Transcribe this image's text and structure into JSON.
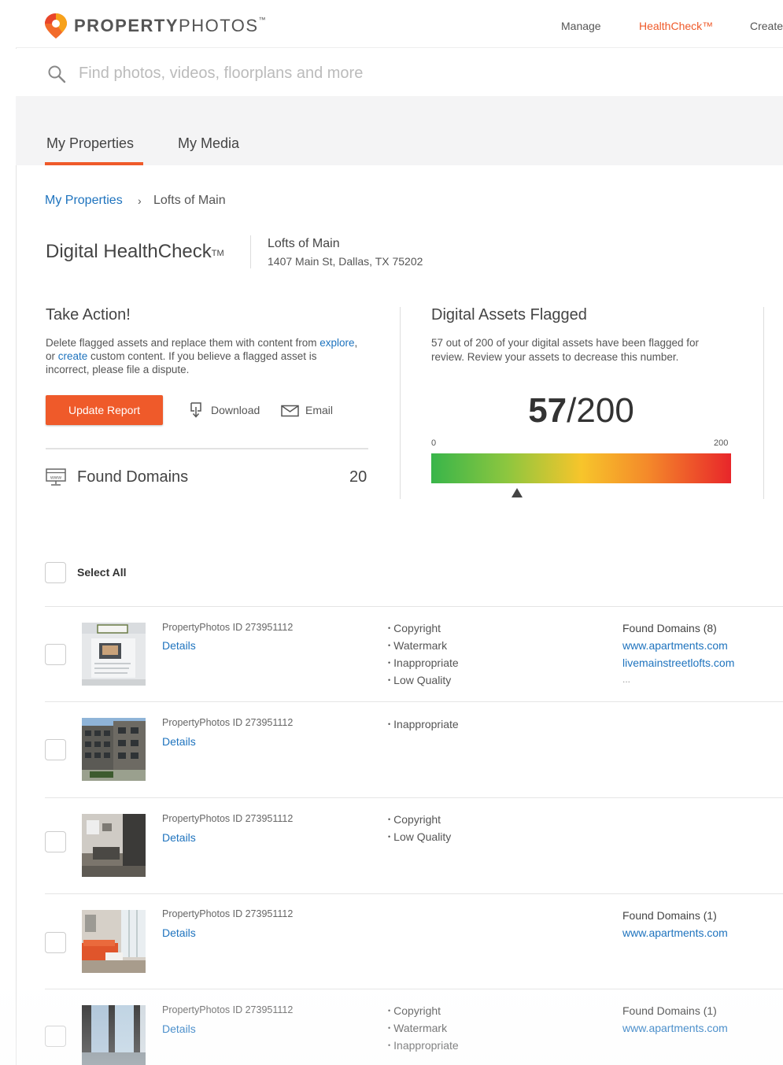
{
  "header": {
    "brand_bold": "PROPERTY",
    "brand_light": "PHOTOS",
    "brand_tm": "™",
    "nav": {
      "manage": "Manage",
      "healthcheck": "HealthCheck™",
      "create": "Create"
    },
    "accent_color": "#ef5a2a"
  },
  "search": {
    "placeholder": "Find photos, videos, floorplans and more"
  },
  "tabs": {
    "my_properties": "My Properties",
    "my_media": "My Media",
    "active": "My Properties"
  },
  "breadcrumb": {
    "link": "My Properties",
    "separator": "›",
    "current": "Lofts of Main"
  },
  "page": {
    "title": "Digital HealthCheck",
    "title_tm": "TM",
    "property_name": "Lofts of Main",
    "property_address": "1407 Main St, Dallas, TX 75202"
  },
  "take_action": {
    "title": "Take Action!",
    "text_1": "Delete flagged assets and replace them with content from ",
    "link_explore": "explore",
    "text_2": ", or ",
    "link_create": "create",
    "text_3": " custom content. If you believe a flagged asset is incorrect, please file a dispute.",
    "update_button": "Update Report",
    "download": "Download",
    "email": "Email",
    "found_domains_label": "Found Domains",
    "found_domains_count": "20"
  },
  "digital_assets": {
    "title": "Digital Assets Flagged",
    "text": "57 out of 200 of your digital assets have been flagged for review. Review your assets to decrease this number.",
    "flagged": "57",
    "total": "/200",
    "scale_min": "0",
    "scale_max": "200",
    "flagged_fraction": 0.285
  },
  "list": {
    "select_all": "Select All",
    "rows": [
      {
        "pp_id": "PropertyPhotos ID  273951112",
        "details": "Details",
        "flags": [
          "Copyright",
          "Watermark",
          "Inappropriate",
          "Low Quality"
        ],
        "domains_header": "Found Domains (8)",
        "domains": [
          "www.apartments.com",
          "livemainstreetlofts.com"
        ],
        "more": "..."
      },
      {
        "pp_id": "PropertyPhotos ID  273951112",
        "details": "Details",
        "flags": [
          "Inappropriate"
        ],
        "domains_header": "",
        "domains": [],
        "more": ""
      },
      {
        "pp_id": "PropertyPhotos ID  273951112",
        "details": "Details",
        "flags": [
          "Copyright",
          "Low Quality"
        ],
        "domains_header": "",
        "domains": [],
        "more": ""
      },
      {
        "pp_id": "PropertyPhotos ID  273951112",
        "details": "Details",
        "flags": [],
        "domains_header": "Found Domains (1)",
        "domains": [
          "www.apartments.com"
        ],
        "more": ""
      },
      {
        "pp_id": "PropertyPhotos ID  273951112",
        "details": "Details",
        "flags": [
          "Copyright",
          "Watermark",
          "Inappropriate"
        ],
        "domains_header": "Found Domains (1)",
        "domains": [
          "www.apartments.com"
        ],
        "more": ""
      }
    ]
  }
}
